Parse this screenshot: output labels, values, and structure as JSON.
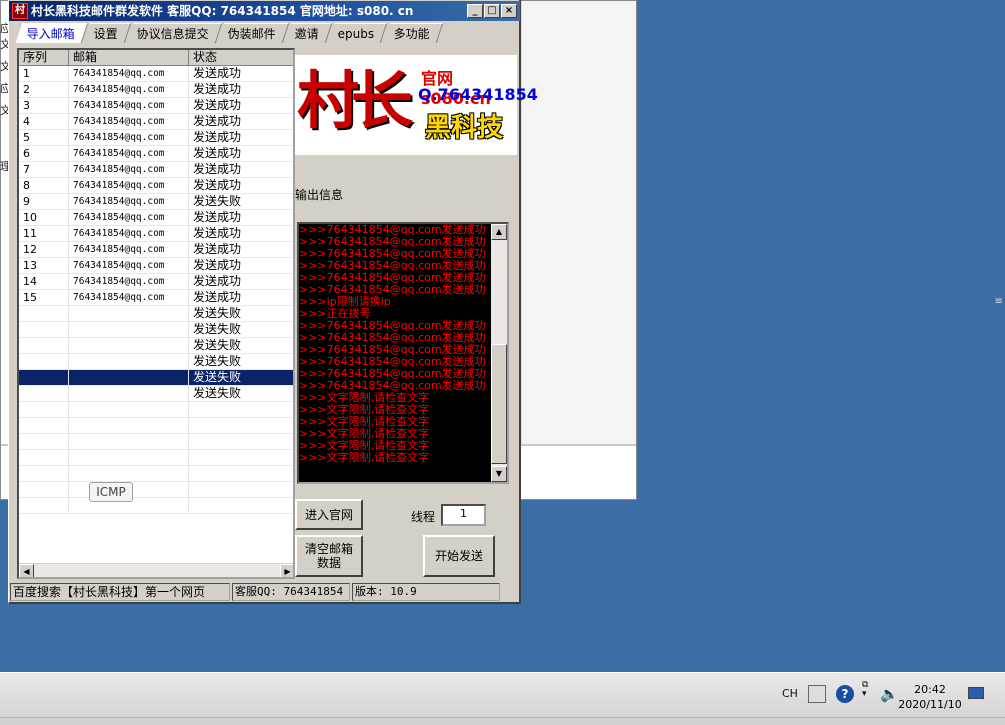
{
  "app": {
    "title": "村长黑科技邮件群发软件  客服QQ: 764341854   官网地址: s080. cn",
    "icon_glyph": "村",
    "tabs": [
      "导入邮箱",
      "设置",
      "协议信息提交",
      "伪装邮件",
      "邀请",
      "epubs",
      "多功能"
    ],
    "active_tab": 0
  },
  "list": {
    "headers": [
      "序列",
      "邮箱",
      "状态"
    ],
    "rows": [
      {
        "n": "1",
        "email": "764341854@qq.com",
        "status": "发送成功"
      },
      {
        "n": "2",
        "email": "764341854@qq.com",
        "status": "发送成功"
      },
      {
        "n": "3",
        "email": "764341854@qq.com",
        "status": "发送成功"
      },
      {
        "n": "4",
        "email": "764341854@qq.com",
        "status": "发送成功"
      },
      {
        "n": "5",
        "email": "764341854@qq.com",
        "status": "发送成功"
      },
      {
        "n": "6",
        "email": "764341854@qq.com",
        "status": "发送成功"
      },
      {
        "n": "7",
        "email": "764341854@qq.com",
        "status": "发送成功"
      },
      {
        "n": "8",
        "email": "764341854@qq.com",
        "status": "发送成功"
      },
      {
        "n": "9",
        "email": "764341854@qq.com",
        "status": "发送失败"
      },
      {
        "n": "10",
        "email": "764341854@qq.com",
        "status": "发送成功"
      },
      {
        "n": "11",
        "email": "764341854@qq.com",
        "status": "发送成功"
      },
      {
        "n": "12",
        "email": "764341854@qq.com",
        "status": "发送成功"
      },
      {
        "n": "13",
        "email": "764341854@qq.com",
        "status": "发送成功"
      },
      {
        "n": "14",
        "email": "764341854@qq.com",
        "status": "发送成功"
      },
      {
        "n": "15",
        "email": "764341854@qq.com",
        "status": "发送成功"
      },
      {
        "n": "",
        "email": "",
        "status": "发送失败"
      },
      {
        "n": "",
        "email": "",
        "status": "发送失败"
      },
      {
        "n": "",
        "email": "",
        "status": "发送失败"
      },
      {
        "n": "",
        "email": "",
        "status": "发送失败"
      },
      {
        "n": "",
        "email": "",
        "status": "发送失败",
        "selected": true
      },
      {
        "n": "",
        "email": "",
        "status": "发送失败"
      }
    ]
  },
  "banner": {
    "logo_text": "村长",
    "line1": "官网 s080.cn",
    "line2": "Q.764341854",
    "line3": "黑科技"
  },
  "output": {
    "label": "输出信息",
    "lines": [
      ">>>764341854@qq.com发送成功",
      ">>>764341854@qq.com发送成功",
      ">>>764341854@qq.com发送成功",
      ">>>764341854@qq.com发送成功",
      ">>>764341854@qq.com发送成功",
      ">>>764341854@qq.com发送成功",
      ">>>ip限制请换ip",
      ">>>正在拨号",
      ">>>764341854@qq.com发送成功",
      ">>>764341854@qq.com发送成功",
      ">>>764341854@qq.com发送成功",
      ">>>764341854@qq.com发送成功",
      ">>>764341854@qq.com发送成功",
      ">>>764341854@qq.com发送成功",
      ">>>文字限制,请检查文字",
      ">>>文字限制,请检查文字",
      ">>>文字限制,请检查文字",
      ">>>文字限制,请检查文字",
      ">>>文字限制,请检查文字",
      ">>>文字限制,请检查文字"
    ]
  },
  "controls": {
    "official_site": "进入官网",
    "clear_mail": "清空邮箱数据",
    "threads_label": "线程",
    "threads_value": "1",
    "start_send": "开始发送"
  },
  "icmp_label": "ICMP",
  "status": {
    "left": "百度搜索【村长黑科技】第一个网页",
    "qq": "客服QQ: 764341854",
    "version": "版本: 10.9"
  },
  "taskbar": {
    "lang": "CH",
    "time": "20:42",
    "date": "2020/11/10"
  },
  "left_edge_glyphs": [
    "应",
    "文",
    "文",
    "应",
    "文",
    "",
    "理"
  ],
  "right_edge_glyph": "≡"
}
